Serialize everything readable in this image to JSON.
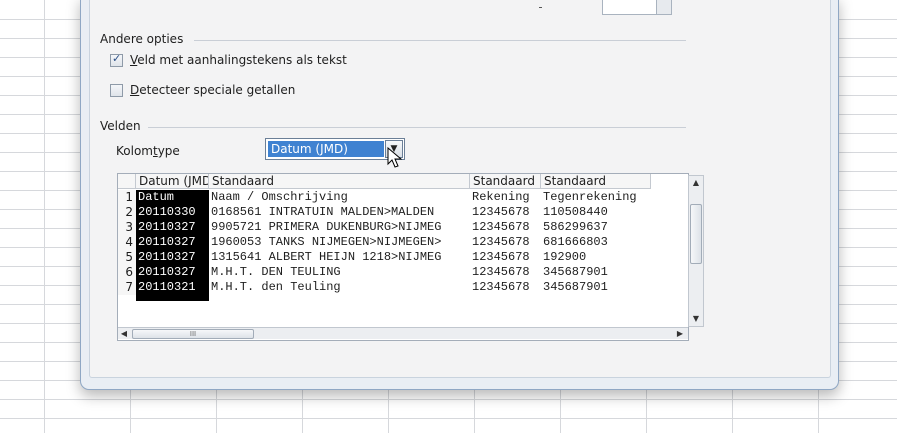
{
  "other_options": {
    "title": "Andere opties",
    "options": [
      {
        "label_u": "V",
        "label_rest": "eld met aanhalingstekens als tekst",
        "checked": true
      },
      {
        "label_u": "D",
        "label_rest": "etecteer speciale getallen",
        "checked": false
      }
    ]
  },
  "fields": {
    "title": "Velden",
    "column_type_label_pre": "Kolom",
    "column_type_label_u": "t",
    "column_type_label_post": "ype",
    "column_type_value": "Datum (JMD)"
  },
  "preview": {
    "headers": [
      "Datum (JMD)",
      "Standaard",
      "Standaard",
      "Standaard"
    ],
    "rows": [
      {
        "n": "1",
        "c0": "Datum",
        "c1": "Naam / Omschrijving",
        "c2": "Rekening",
        "c3": "Tegenrekening"
      },
      {
        "n": "2",
        "c0": "20110330",
        "c1": "0168561 INTRATUIN MALDEN>MALDEN",
        "c2": "12345678",
        "c3": "110508440"
      },
      {
        "n": "3",
        "c0": "20110327",
        "c1": "9905721 PRIMERA DUKENBURG>NIJMEG",
        "c2": "12345678",
        "c3": "586299637"
      },
      {
        "n": "4",
        "c0": "20110327",
        "c1": "1960053 TANKS NIJMEGEN>NIJMEGEN>",
        "c2": "12345678",
        "c3": "681666803"
      },
      {
        "n": "5",
        "c0": "20110327",
        "c1": "1315641 ALBERT HEIJN 1218>NIJMEG",
        "c2": "12345678",
        "c3": "192900"
      },
      {
        "n": "6",
        "c0": "20110327",
        "c1": "M.H.T. DEN TEULING",
        "c2": "12345678",
        "c3": "345687901"
      },
      {
        "n": "7",
        "c0": "20110321",
        "c1": "M.H.T. den Teuling",
        "c2": "12345678",
        "c3": "345687901"
      }
    ],
    "hscroll_grip": "III"
  }
}
